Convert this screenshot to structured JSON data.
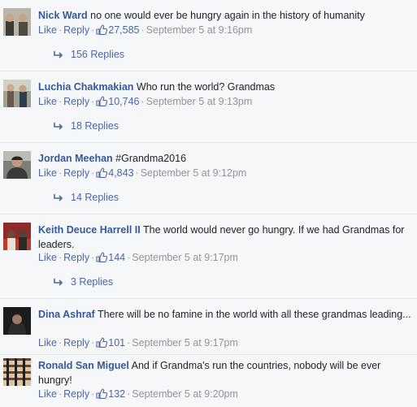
{
  "comments": [
    {
      "author": "Nick Ward",
      "text": "no one would ever be hungry again in the history of humanity",
      "like_label": "Like",
      "reply_label": "Reply",
      "likes": "27,585",
      "timestamp": "September 5 at 9:16pm",
      "replies": "156 Replies"
    },
    {
      "author": "Luchia Chakmakian",
      "text": "Who run the world? Grandmas",
      "like_label": "Like",
      "reply_label": "Reply",
      "likes": "10,746",
      "timestamp": "September 5 at 9:13pm",
      "replies": "18 Replies"
    },
    {
      "author": "Jordan Meehan",
      "text": "#Grandma2016",
      "like_label": "Like",
      "reply_label": "Reply",
      "likes": "4,843",
      "timestamp": "September 5 at 9:12pm",
      "replies": "14 Replies"
    },
    {
      "author": "Keith Deuce Harrell II",
      "text": "The world would never go hungry. If we had Grandmas for leaders.",
      "like_label": "Like",
      "reply_label": "Reply",
      "likes": "144",
      "timestamp": "September 5 at 9:17pm",
      "replies": "3 Replies"
    },
    {
      "author": "Dina Ashraf",
      "text": "There will be no famine in the world with all these grandmas leading...",
      "like_label": "Like",
      "reply_label": "Reply",
      "likes": "101",
      "timestamp": "September 5 at 9:17pm"
    },
    {
      "author": "Ronald San Miguel",
      "text": "And if Grandma's run the countries, nobody will be ever hungry!",
      "like_label": "Like",
      "reply_label": "Reply",
      "likes": "132",
      "timestamp": "September 5 at 9:20pm"
    }
  ],
  "colors": {
    "background": "#f6f7f9",
    "author": "#365899",
    "link": "#4b67a1",
    "meta": "#90949c",
    "text": "#1d2129"
  },
  "icons": [
    "thumbs-up-icon",
    "reply-arrow-icon"
  ]
}
